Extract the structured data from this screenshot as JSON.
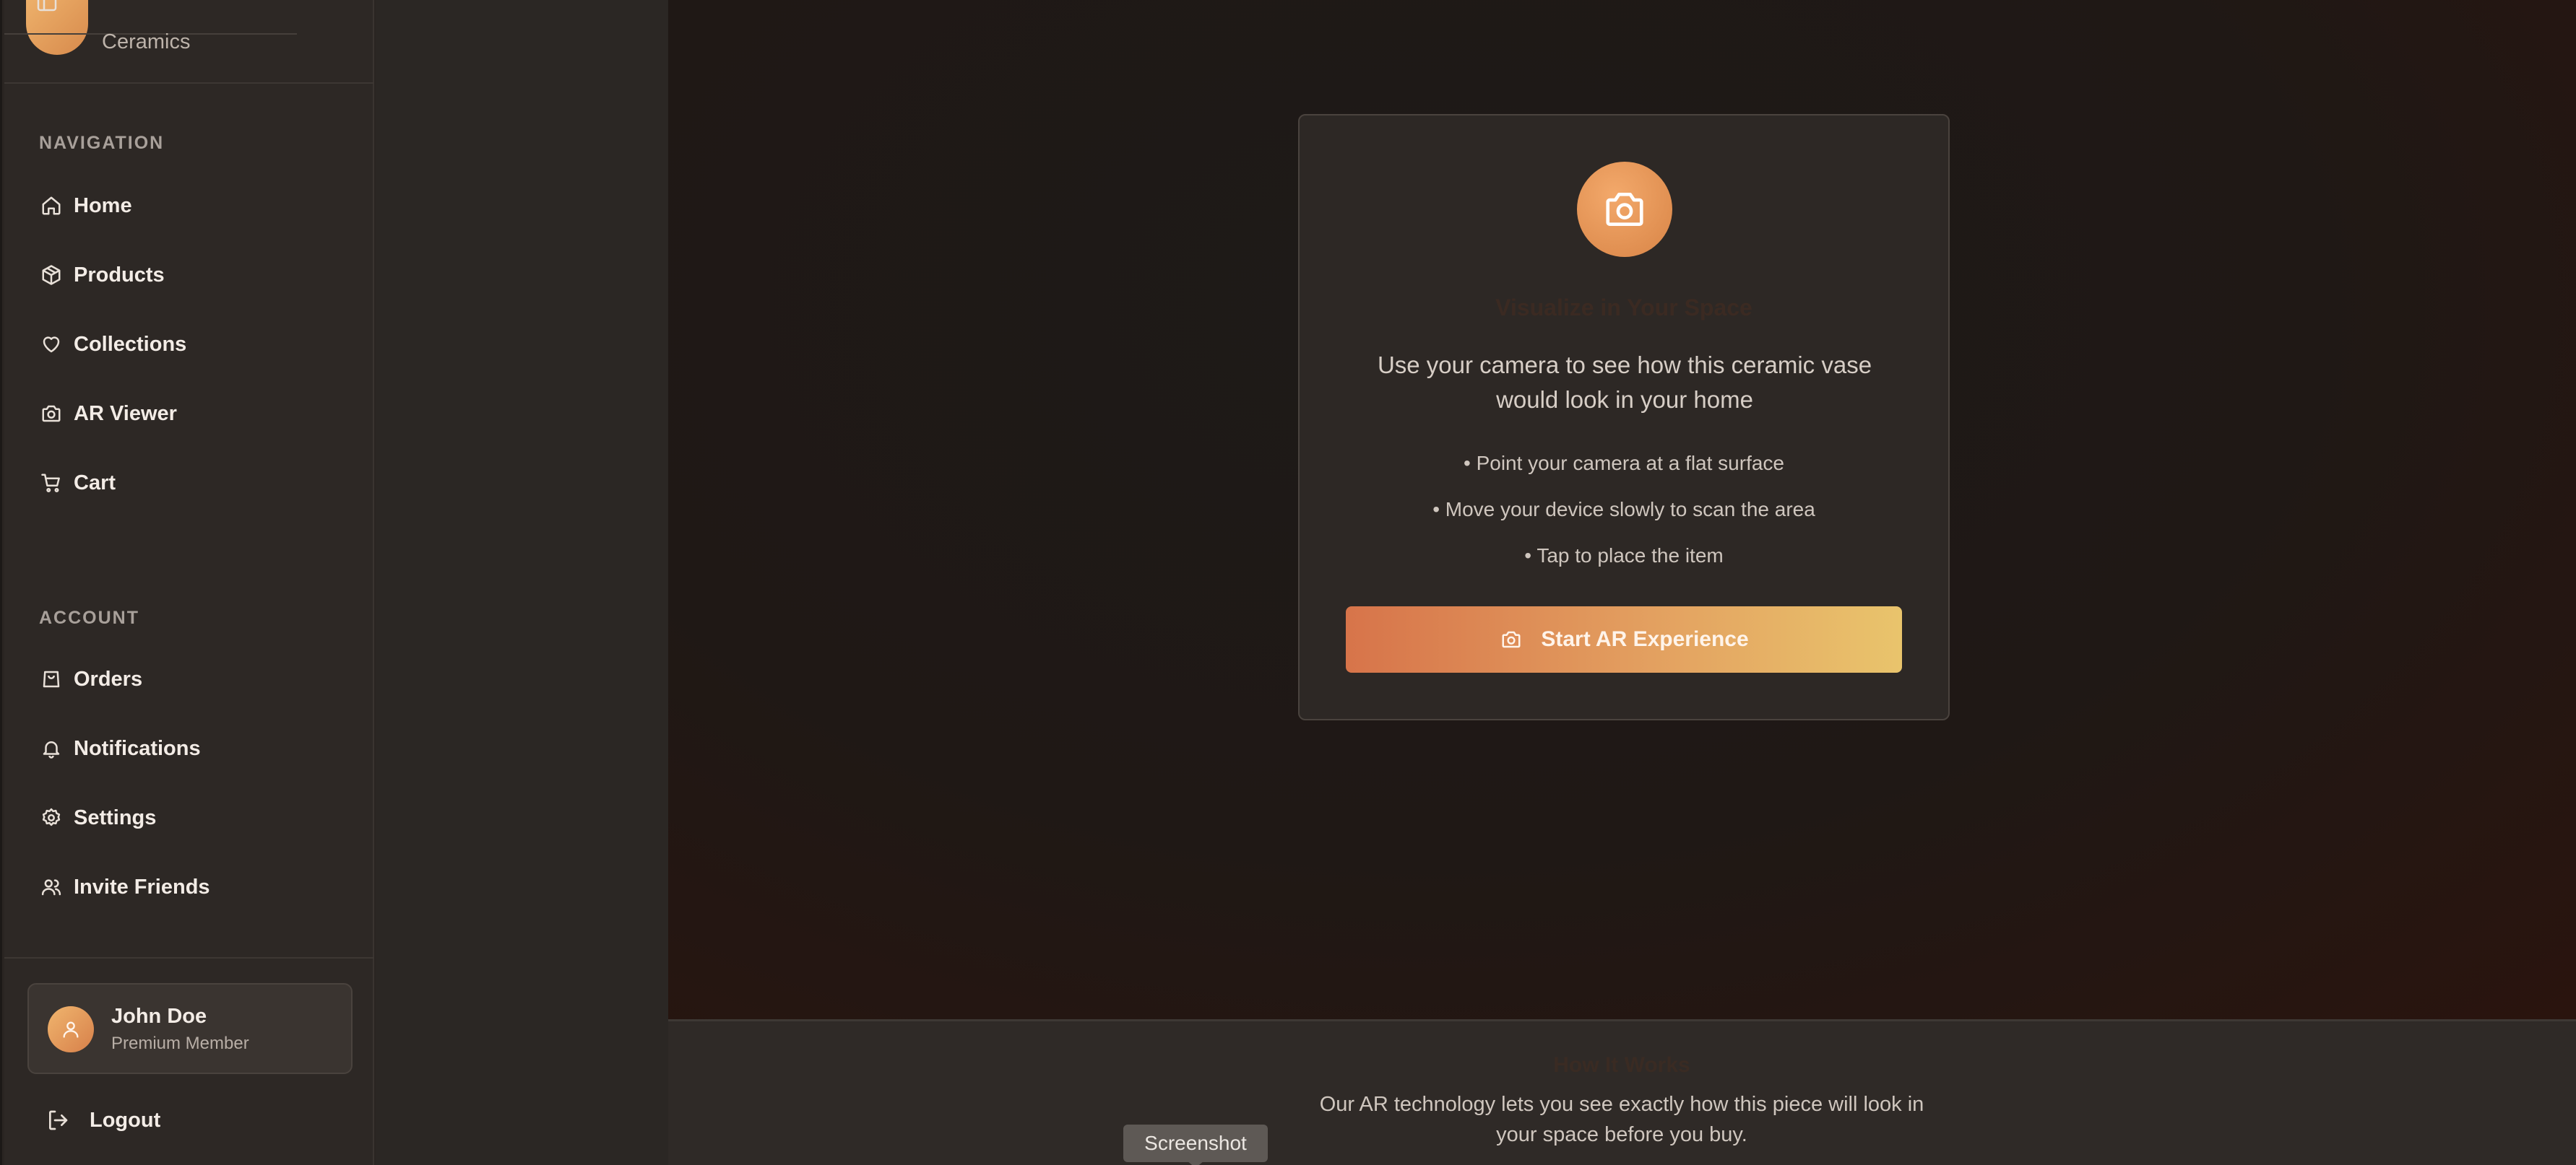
{
  "brand": {
    "name": "Ceramics"
  },
  "sidebar": {
    "navigation_label": "NAVIGATION",
    "navigation": [
      {
        "label": "Home",
        "icon": "home-icon"
      },
      {
        "label": "Products",
        "icon": "package-icon"
      },
      {
        "label": "Collections",
        "icon": "heart-icon"
      },
      {
        "label": "AR Viewer",
        "icon": "camera-icon"
      },
      {
        "label": "Cart",
        "icon": "cart-icon"
      }
    ],
    "account_label": "ACCOUNT",
    "account": [
      {
        "label": "Orders",
        "icon": "shopping-bag-icon"
      },
      {
        "label": "Notifications",
        "icon": "bell-icon"
      },
      {
        "label": "Settings",
        "icon": "gear-icon"
      },
      {
        "label": "Invite Friends",
        "icon": "users-icon"
      }
    ],
    "user": {
      "name": "John Doe",
      "role": "Premium Member"
    },
    "logout_label": "Logout"
  },
  "ar_card": {
    "title": "Visualize in Your Space",
    "description": "Use your camera to see how this ceramic vase would look in your home",
    "steps": [
      "• Point your camera at a flat surface",
      "• Move your device slowly to scan the area",
      "• Tap to place the item"
    ],
    "button_label": "Start AR Experience"
  },
  "info": {
    "title": "How It Works",
    "text": "Our AR technology lets you see exactly how this piece will look in your space before you buy."
  },
  "tooltip": {
    "label": "Screenshot"
  },
  "colors": {
    "accent_start": "#d7744a",
    "accent_end": "#e9c46c",
    "background": "#1f1815",
    "sidebar": "#2d2825"
  }
}
